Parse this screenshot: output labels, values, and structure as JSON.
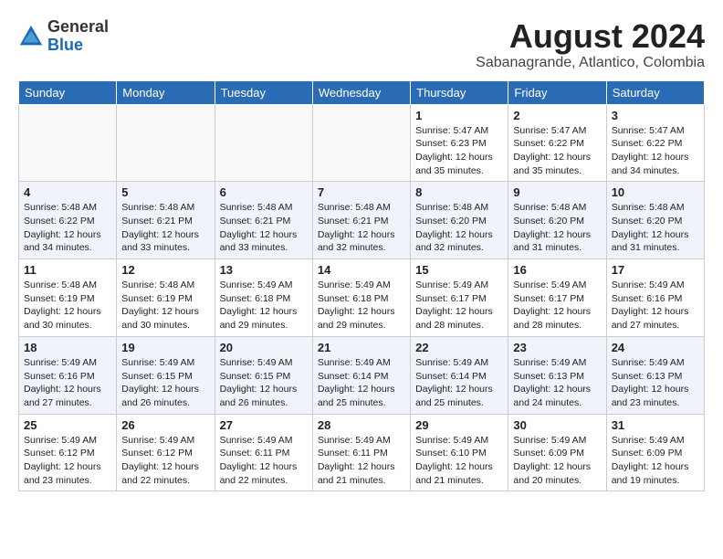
{
  "logo": {
    "general": "General",
    "blue": "Blue"
  },
  "title": {
    "month_year": "August 2024",
    "location": "Sabanagrande, Atlantico, Colombia"
  },
  "days_of_week": [
    "Sunday",
    "Monday",
    "Tuesday",
    "Wednesday",
    "Thursday",
    "Friday",
    "Saturday"
  ],
  "weeks": [
    [
      {
        "day": "",
        "info": ""
      },
      {
        "day": "",
        "info": ""
      },
      {
        "day": "",
        "info": ""
      },
      {
        "day": "",
        "info": ""
      },
      {
        "day": "1",
        "info": "Sunrise: 5:47 AM\nSunset: 6:23 PM\nDaylight: 12 hours\nand 35 minutes."
      },
      {
        "day": "2",
        "info": "Sunrise: 5:47 AM\nSunset: 6:22 PM\nDaylight: 12 hours\nand 35 minutes."
      },
      {
        "day": "3",
        "info": "Sunrise: 5:47 AM\nSunset: 6:22 PM\nDaylight: 12 hours\nand 34 minutes."
      }
    ],
    [
      {
        "day": "4",
        "info": "Sunrise: 5:48 AM\nSunset: 6:22 PM\nDaylight: 12 hours\nand 34 minutes."
      },
      {
        "day": "5",
        "info": "Sunrise: 5:48 AM\nSunset: 6:21 PM\nDaylight: 12 hours\nand 33 minutes."
      },
      {
        "day": "6",
        "info": "Sunrise: 5:48 AM\nSunset: 6:21 PM\nDaylight: 12 hours\nand 33 minutes."
      },
      {
        "day": "7",
        "info": "Sunrise: 5:48 AM\nSunset: 6:21 PM\nDaylight: 12 hours\nand 32 minutes."
      },
      {
        "day": "8",
        "info": "Sunrise: 5:48 AM\nSunset: 6:20 PM\nDaylight: 12 hours\nand 32 minutes."
      },
      {
        "day": "9",
        "info": "Sunrise: 5:48 AM\nSunset: 6:20 PM\nDaylight: 12 hours\nand 31 minutes."
      },
      {
        "day": "10",
        "info": "Sunrise: 5:48 AM\nSunset: 6:20 PM\nDaylight: 12 hours\nand 31 minutes."
      }
    ],
    [
      {
        "day": "11",
        "info": "Sunrise: 5:48 AM\nSunset: 6:19 PM\nDaylight: 12 hours\nand 30 minutes."
      },
      {
        "day": "12",
        "info": "Sunrise: 5:48 AM\nSunset: 6:19 PM\nDaylight: 12 hours\nand 30 minutes."
      },
      {
        "day": "13",
        "info": "Sunrise: 5:49 AM\nSunset: 6:18 PM\nDaylight: 12 hours\nand 29 minutes."
      },
      {
        "day": "14",
        "info": "Sunrise: 5:49 AM\nSunset: 6:18 PM\nDaylight: 12 hours\nand 29 minutes."
      },
      {
        "day": "15",
        "info": "Sunrise: 5:49 AM\nSunset: 6:17 PM\nDaylight: 12 hours\nand 28 minutes."
      },
      {
        "day": "16",
        "info": "Sunrise: 5:49 AM\nSunset: 6:17 PM\nDaylight: 12 hours\nand 28 minutes."
      },
      {
        "day": "17",
        "info": "Sunrise: 5:49 AM\nSunset: 6:16 PM\nDaylight: 12 hours\nand 27 minutes."
      }
    ],
    [
      {
        "day": "18",
        "info": "Sunrise: 5:49 AM\nSunset: 6:16 PM\nDaylight: 12 hours\nand 27 minutes."
      },
      {
        "day": "19",
        "info": "Sunrise: 5:49 AM\nSunset: 6:15 PM\nDaylight: 12 hours\nand 26 minutes."
      },
      {
        "day": "20",
        "info": "Sunrise: 5:49 AM\nSunset: 6:15 PM\nDaylight: 12 hours\nand 26 minutes."
      },
      {
        "day": "21",
        "info": "Sunrise: 5:49 AM\nSunset: 6:14 PM\nDaylight: 12 hours\nand 25 minutes."
      },
      {
        "day": "22",
        "info": "Sunrise: 5:49 AM\nSunset: 6:14 PM\nDaylight: 12 hours\nand 25 minutes."
      },
      {
        "day": "23",
        "info": "Sunrise: 5:49 AM\nSunset: 6:13 PM\nDaylight: 12 hours\nand 24 minutes."
      },
      {
        "day": "24",
        "info": "Sunrise: 5:49 AM\nSunset: 6:13 PM\nDaylight: 12 hours\nand 23 minutes."
      }
    ],
    [
      {
        "day": "25",
        "info": "Sunrise: 5:49 AM\nSunset: 6:12 PM\nDaylight: 12 hours\nand 23 minutes."
      },
      {
        "day": "26",
        "info": "Sunrise: 5:49 AM\nSunset: 6:12 PM\nDaylight: 12 hours\nand 22 minutes."
      },
      {
        "day": "27",
        "info": "Sunrise: 5:49 AM\nSunset: 6:11 PM\nDaylight: 12 hours\nand 22 minutes."
      },
      {
        "day": "28",
        "info": "Sunrise: 5:49 AM\nSunset: 6:11 PM\nDaylight: 12 hours\nand 21 minutes."
      },
      {
        "day": "29",
        "info": "Sunrise: 5:49 AM\nSunset: 6:10 PM\nDaylight: 12 hours\nand 21 minutes."
      },
      {
        "day": "30",
        "info": "Sunrise: 5:49 AM\nSunset: 6:09 PM\nDaylight: 12 hours\nand 20 minutes."
      },
      {
        "day": "31",
        "info": "Sunrise: 5:49 AM\nSunset: 6:09 PM\nDaylight: 12 hours\nand 19 minutes."
      }
    ]
  ]
}
